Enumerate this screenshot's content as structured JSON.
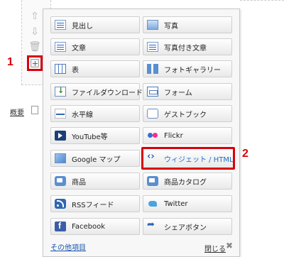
{
  "callouts": {
    "one": "1",
    "two": "2"
  },
  "bottom_link": "概要",
  "menu": {
    "items": [
      {
        "label": "見出し",
        "icon": "heading-icon"
      },
      {
        "label": "写真",
        "icon": "photo-icon"
      },
      {
        "label": "文章",
        "icon": "text-icon"
      },
      {
        "label": "写真付き文章",
        "icon": "photo-text-icon"
      },
      {
        "label": "表",
        "icon": "table-icon"
      },
      {
        "label": "フォトギャラリー",
        "icon": "photo-gallery-icon"
      },
      {
        "label": "ファイルダウンロード",
        "icon": "file-download-icon"
      },
      {
        "label": "フォーム",
        "icon": "form-icon"
      },
      {
        "label": "水平線",
        "icon": "horizontal-line-icon"
      },
      {
        "label": "ゲストブック",
        "icon": "guestbook-icon"
      },
      {
        "label": "YouTube等",
        "icon": "youtube-icon"
      },
      {
        "label": "Flickr",
        "icon": "flickr-icon"
      },
      {
        "label": "Google マップ",
        "icon": "map-icon"
      },
      {
        "label": "ウィジェット / HTML",
        "icon": "widget-icon"
      },
      {
        "label": "商品",
        "icon": "product-icon"
      },
      {
        "label": "商品カタログ",
        "icon": "catalog-icon"
      },
      {
        "label": "RSSフィード",
        "icon": "rss-icon"
      },
      {
        "label": "Twitter",
        "icon": "twitter-icon"
      },
      {
        "label": "Facebook",
        "icon": "facebook-icon"
      },
      {
        "label": "シェアボタン",
        "icon": "share-icon"
      }
    ],
    "other_items": "その他項目",
    "close": "閉じる"
  },
  "colors": {
    "accent_red": "#d8000c",
    "link_blue": "#1a55b0"
  }
}
